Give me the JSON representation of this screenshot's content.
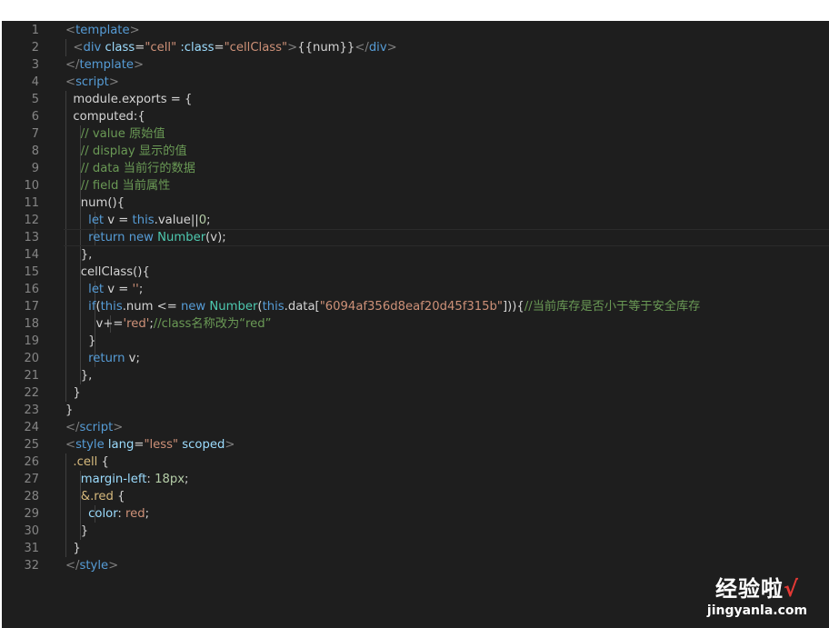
{
  "editor": {
    "theme": {
      "background": "#1e1e1e",
      "line_number_color": "#858585",
      "keyword_color": "#569cd6",
      "string_color": "#ce9178",
      "comment_color": "#6a9955",
      "type_color": "#4ec9b0",
      "number_color": "#b5cea8"
    },
    "current_line": 13,
    "lines": [
      {
        "n": "1",
        "guides": 0,
        "tokens": [
          [
            "tk-punct",
            "<"
          ],
          [
            "tk-tag",
            "template"
          ],
          [
            "tk-punct",
            ">"
          ]
        ]
      },
      {
        "n": "2",
        "guides": 1,
        "tokens": [
          [
            "tk-plain",
            "  "
          ],
          [
            "tk-punct",
            "<"
          ],
          [
            "tk-tag",
            "div"
          ],
          [
            "tk-plain",
            " "
          ],
          [
            "tk-attr",
            "class"
          ],
          [
            "tk-plain",
            "="
          ],
          [
            "tk-str",
            "\"cell\""
          ],
          [
            "tk-plain",
            " "
          ],
          [
            "tk-attr",
            ":class"
          ],
          [
            "tk-plain",
            "="
          ],
          [
            "tk-str",
            "\"cellClass\""
          ],
          [
            "tk-punct",
            ">"
          ],
          [
            "tk-plain",
            "{{num}}"
          ],
          [
            "tk-punct",
            "</"
          ],
          [
            "tk-tag",
            "div"
          ],
          [
            "tk-punct",
            ">"
          ]
        ]
      },
      {
        "n": "3",
        "guides": 0,
        "tokens": [
          [
            "tk-punct",
            "</"
          ],
          [
            "tk-tag",
            "template"
          ],
          [
            "tk-punct",
            ">"
          ]
        ]
      },
      {
        "n": "4",
        "guides": 0,
        "tokens": [
          [
            "tk-punct",
            "<"
          ],
          [
            "tk-tag",
            "script"
          ],
          [
            "tk-punct",
            ">"
          ]
        ]
      },
      {
        "n": "5",
        "guides": 1,
        "tokens": [
          [
            "tk-plain",
            "  module.exports = {"
          ]
        ]
      },
      {
        "n": "6",
        "guides": 1,
        "tokens": [
          [
            "tk-plain",
            "  computed:{"
          ]
        ]
      },
      {
        "n": "7",
        "guides": 2,
        "tokens": [
          [
            "tk-plain",
            "    "
          ],
          [
            "tk-com",
            "// value 原始值"
          ]
        ]
      },
      {
        "n": "8",
        "guides": 2,
        "tokens": [
          [
            "tk-plain",
            "    "
          ],
          [
            "tk-com",
            "// display 显示的值"
          ]
        ]
      },
      {
        "n": "9",
        "guides": 2,
        "tokens": [
          [
            "tk-plain",
            "    "
          ],
          [
            "tk-com",
            "// data 当前行的数据"
          ]
        ]
      },
      {
        "n": "10",
        "guides": 2,
        "tokens": [
          [
            "tk-plain",
            "    "
          ],
          [
            "tk-com",
            "// field 当前属性"
          ]
        ]
      },
      {
        "n": "11",
        "guides": 2,
        "tokens": [
          [
            "tk-plain",
            "    num(){"
          ]
        ]
      },
      {
        "n": "12",
        "guides": 3,
        "tokens": [
          [
            "tk-plain",
            "      "
          ],
          [
            "tk-kw",
            "let"
          ],
          [
            "tk-plain",
            " v = "
          ],
          [
            "tk-kw",
            "this"
          ],
          [
            "tk-plain",
            ".value||"
          ],
          [
            "tk-num",
            "0"
          ],
          [
            "tk-plain",
            ";"
          ]
        ]
      },
      {
        "n": "13",
        "guides": 3,
        "tokens": [
          [
            "tk-plain",
            "      "
          ],
          [
            "tk-kw",
            "return"
          ],
          [
            "tk-plain",
            " "
          ],
          [
            "tk-kw",
            "new"
          ],
          [
            "tk-plain",
            " "
          ],
          [
            "tk-class",
            "Number"
          ],
          [
            "tk-plain",
            "(v);"
          ]
        ]
      },
      {
        "n": "14",
        "guides": 2,
        "tokens": [
          [
            "tk-plain",
            "    },"
          ]
        ]
      },
      {
        "n": "15",
        "guides": 2,
        "tokens": [
          [
            "tk-plain",
            "    cellClass(){"
          ]
        ]
      },
      {
        "n": "16",
        "guides": 3,
        "tokens": [
          [
            "tk-plain",
            "      "
          ],
          [
            "tk-kw",
            "let"
          ],
          [
            "tk-plain",
            " v = "
          ],
          [
            "tk-str",
            "''"
          ],
          [
            "tk-plain",
            ";"
          ]
        ]
      },
      {
        "n": "17",
        "guides": 3,
        "tokens": [
          [
            "tk-plain",
            "      "
          ],
          [
            "tk-kw",
            "if"
          ],
          [
            "tk-plain",
            "("
          ],
          [
            "tk-kw",
            "this"
          ],
          [
            "tk-plain",
            ".num <= "
          ],
          [
            "tk-kw",
            "new"
          ],
          [
            "tk-plain",
            " "
          ],
          [
            "tk-class",
            "Number"
          ],
          [
            "tk-plain",
            "("
          ],
          [
            "tk-kw",
            "this"
          ],
          [
            "tk-plain",
            ".data["
          ],
          [
            "tk-str",
            "\"6094af356d8eaf20d45f315b\""
          ],
          [
            "tk-plain",
            "])){"
          ],
          [
            "tk-com",
            "//当前库存是否小于等于安全库存"
          ]
        ]
      },
      {
        "n": "18",
        "guides": 4,
        "tokens": [
          [
            "tk-plain",
            "        v+="
          ],
          [
            "tk-str",
            "'red'"
          ],
          [
            "tk-plain",
            ";"
          ],
          [
            "tk-com",
            "//class名称改为“red”"
          ]
        ]
      },
      {
        "n": "19",
        "guides": 3,
        "tokens": [
          [
            "tk-plain",
            "      }"
          ]
        ]
      },
      {
        "n": "20",
        "guides": 3,
        "tokens": [
          [
            "tk-plain",
            "      "
          ],
          [
            "tk-kw",
            "return"
          ],
          [
            "tk-plain",
            " v;"
          ]
        ]
      },
      {
        "n": "21",
        "guides": 2,
        "tokens": [
          [
            "tk-plain",
            "    },"
          ]
        ]
      },
      {
        "n": "22",
        "guides": 1,
        "tokens": [
          [
            "tk-plain",
            "  }"
          ]
        ]
      },
      {
        "n": "23",
        "guides": 0,
        "tokens": [
          [
            "tk-plain",
            "}"
          ]
        ]
      },
      {
        "n": "24",
        "guides": 0,
        "tokens": [
          [
            "tk-punct",
            "</"
          ],
          [
            "tk-tag",
            "script"
          ],
          [
            "tk-punct",
            ">"
          ]
        ]
      },
      {
        "n": "25",
        "guides": 0,
        "tokens": [
          [
            "tk-punct",
            "<"
          ],
          [
            "tk-tag",
            "style"
          ],
          [
            "tk-plain",
            " "
          ],
          [
            "tk-attr",
            "lang"
          ],
          [
            "tk-plain",
            "="
          ],
          [
            "tk-str",
            "\"less\""
          ],
          [
            "tk-plain",
            " "
          ],
          [
            "tk-attr",
            "scoped"
          ],
          [
            "tk-punct",
            ">"
          ]
        ]
      },
      {
        "n": "26",
        "guides": 1,
        "tokens": [
          [
            "tk-plain",
            "  "
          ],
          [
            "tk-sel",
            ".cell"
          ],
          [
            "tk-plain",
            " {"
          ]
        ]
      },
      {
        "n": "27",
        "guides": 2,
        "tokens": [
          [
            "tk-plain",
            "    "
          ],
          [
            "tk-prop",
            "margin-left"
          ],
          [
            "tk-plain",
            ": "
          ],
          [
            "tk-num",
            "18px"
          ],
          [
            "tk-plain",
            ";"
          ]
        ]
      },
      {
        "n": "28",
        "guides": 2,
        "tokens": [
          [
            "tk-plain",
            "    "
          ],
          [
            "tk-sel",
            "&.red"
          ],
          [
            "tk-plain",
            " {"
          ]
        ]
      },
      {
        "n": "29",
        "guides": 3,
        "tokens": [
          [
            "tk-plain",
            "      "
          ],
          [
            "tk-prop",
            "color"
          ],
          [
            "tk-plain",
            ": "
          ],
          [
            "tk-str",
            "red"
          ],
          [
            "tk-plain",
            ";"
          ]
        ]
      },
      {
        "n": "30",
        "guides": 2,
        "tokens": [
          [
            "tk-plain",
            "    }"
          ]
        ]
      },
      {
        "n": "31",
        "guides": 1,
        "tokens": [
          [
            "tk-plain",
            "  }"
          ]
        ]
      },
      {
        "n": "32",
        "guides": 0,
        "tokens": [
          [
            "tk-punct",
            "</"
          ],
          [
            "tk-tag",
            "style"
          ],
          [
            "tk-punct",
            ">"
          ]
        ]
      }
    ]
  },
  "watermark": {
    "brand": "经验啦",
    "check": "√",
    "url": "jingyanla.com"
  }
}
